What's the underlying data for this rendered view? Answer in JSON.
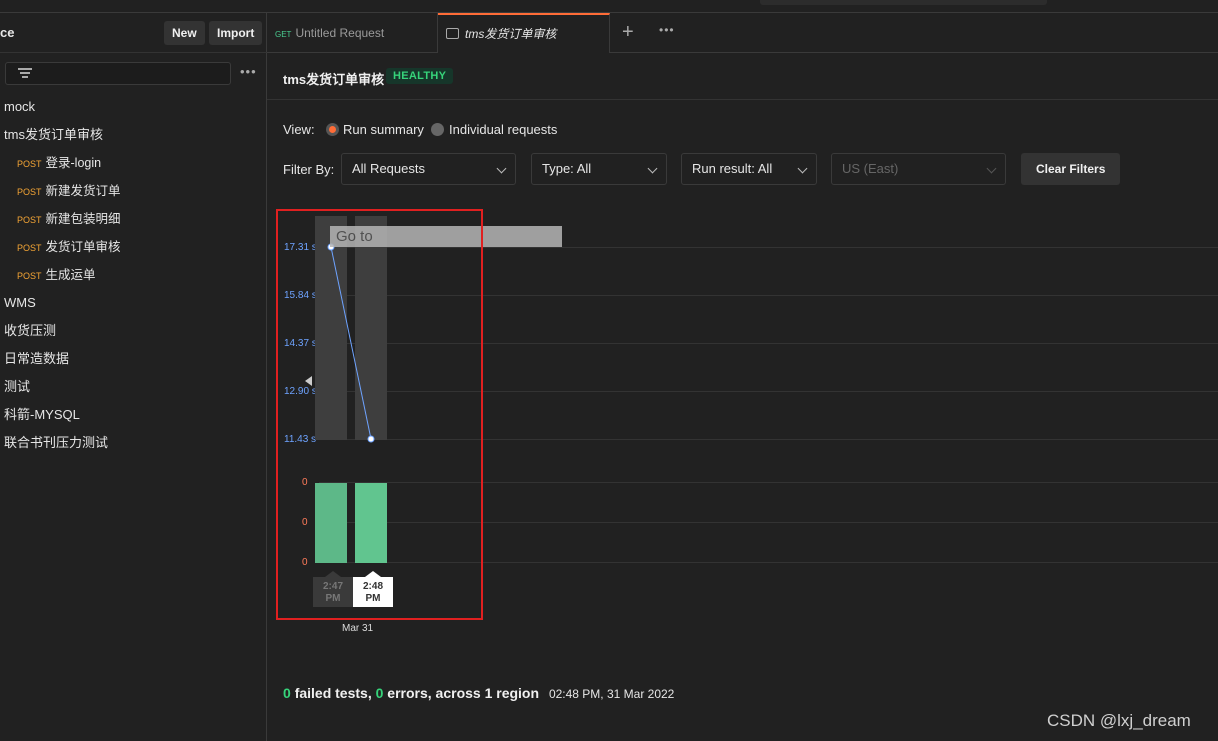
{
  "sidebar": {
    "title": "ce",
    "new_label": "New",
    "import_label": "Import",
    "items": [
      {
        "label": "mock"
      },
      {
        "label": "tms发货订单审核"
      },
      {
        "method": "POST",
        "label": "登录-login"
      },
      {
        "method": "POST",
        "label": "新建发货订单"
      },
      {
        "method": "POST",
        "label": "新建包装明细"
      },
      {
        "method": "POST",
        "label": "发货订单审核"
      },
      {
        "method": "POST",
        "label": "生成运单"
      },
      {
        "label": "WMS"
      },
      {
        "label": "收货压测"
      },
      {
        "label": "日常造数据"
      },
      {
        "label": "测试"
      },
      {
        "label": "科箭-MYSQL"
      },
      {
        "label": "联合书刊压力测试"
      }
    ]
  },
  "tabs": [
    {
      "method": "GET",
      "label": "Untitled Request"
    },
    {
      "label": "tms发货订单审核"
    }
  ],
  "header": {
    "title": "tms发货订单审核",
    "status": "HEALTHY"
  },
  "view": {
    "label": "View:",
    "option_run_summary": "Run summary",
    "option_individual": "Individual requests",
    "selected": "Run summary"
  },
  "filters": {
    "label": "Filter By:",
    "requests": "All Requests",
    "type": "Type: All",
    "run_result": "Run result: All",
    "region": "US (East)",
    "clear": "Clear Filters"
  },
  "chart_data": {
    "type": "line",
    "y_ticks": [
      "17.31 s",
      "15.84 s",
      "14.37 s",
      "12.90 s",
      "11.43 s"
    ],
    "x_labels": [
      {
        "time": "2:47",
        "period": "PM"
      },
      {
        "time": "2:48",
        "period": "PM"
      }
    ],
    "date": "Mar 31",
    "series": [
      {
        "values": [
          17.31,
          11.43
        ]
      }
    ],
    "error_ticks": [
      "0",
      "0",
      "0"
    ],
    "overlay_text": "Go to"
  },
  "summary": {
    "failed_count": "0",
    "failed_text": "failed tests,",
    "errors_count": "0",
    "errors_text": "errors, across 1 region",
    "timestamp": "02:48 PM, 31 Mar 2022"
  },
  "watermark": "CSDN @lxj_dream",
  "colors": {
    "accent": "#ff6c37",
    "healthy": "#36d37a",
    "line": "#6ea3ff"
  }
}
